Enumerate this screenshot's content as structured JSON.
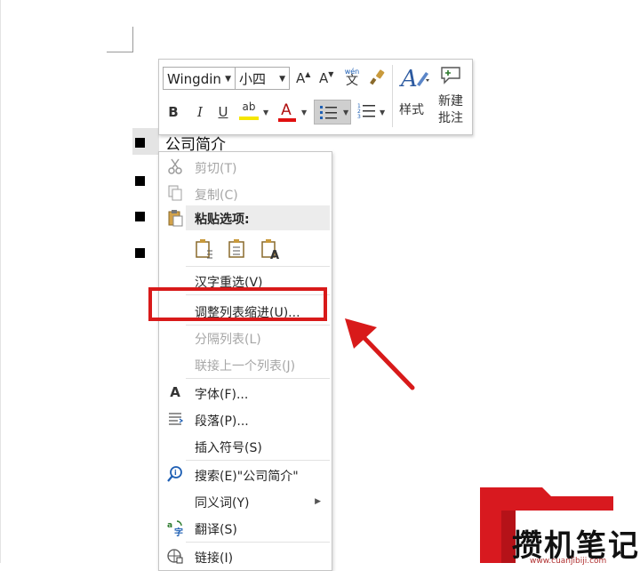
{
  "document": {
    "heading": "公司简介"
  },
  "mini_toolbar": {
    "font_name": "Wingdin",
    "font_size": "小四",
    "grow_font": "A",
    "shrink_font": "A",
    "phonetic_top": "wén",
    "phonetic_bottom": "文",
    "bold": "B",
    "italic": "I",
    "underline": "U",
    "highlight_label": "ab",
    "font_color_label": "A",
    "styles_label": "样式",
    "new_comment_line1": "新建",
    "new_comment_line2": "批注",
    "colors": {
      "highlight": "#f5e600",
      "font_color": "#e01010"
    }
  },
  "context_menu": {
    "items": [
      {
        "label": "剪切(T)",
        "enabled": false,
        "icon": "scissors-icon"
      },
      {
        "label": "复制(C)",
        "enabled": false,
        "icon": "copy-icon"
      },
      {
        "label": "粘贴选项:",
        "enabled": true,
        "icon": "clipboard-icon"
      },
      {
        "label": "汉字重选(V)",
        "enabled": true
      },
      {
        "label": "调整列表缩进(U)...",
        "enabled": true
      },
      {
        "label": "分隔列表(L)",
        "enabled": false
      },
      {
        "label": "联接上一个列表(J)",
        "enabled": false
      },
      {
        "label": "字体(F)...",
        "enabled": true,
        "icon": "font-icon"
      },
      {
        "label": "段落(P)...",
        "enabled": true,
        "icon": "paragraph-icon"
      },
      {
        "label": "插入符号(S)",
        "enabled": true
      },
      {
        "label": "搜索(E)\"公司简介\"",
        "enabled": true,
        "icon": "search-icon"
      },
      {
        "label": "同义词(Y)",
        "enabled": true,
        "has_submenu": true
      },
      {
        "label": "翻译(S)",
        "enabled": true,
        "icon": "translate-icon"
      },
      {
        "label": "链接(I)",
        "enabled": true,
        "icon": "link-icon"
      }
    ],
    "paste_options": [
      "paste-keep-source-icon",
      "paste-merge-icon",
      "paste-text-only-icon"
    ],
    "font_icon_glyph": "A"
  },
  "annotation": {
    "highlight_color": "#d81a1a"
  },
  "watermark": {
    "text": "攒机笔记",
    "url": "www.cuanjibiji.com"
  }
}
